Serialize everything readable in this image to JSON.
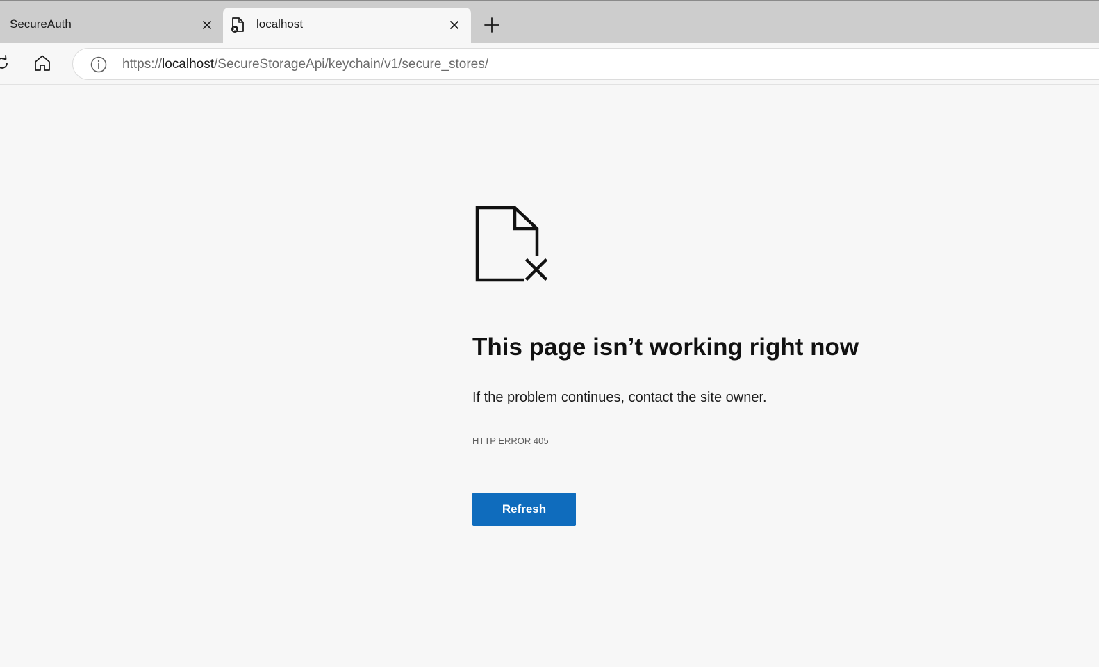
{
  "tabs": [
    {
      "title": "SecureAuth",
      "active": false
    },
    {
      "title": "localhost",
      "active": true,
      "favicon": "document-error-icon"
    }
  ],
  "toolbar": {
    "url_prefix": "https://",
    "url_host": "localhost",
    "url_path": "/SecureStorageApi/keychain/v1/secure_stores/"
  },
  "error": {
    "icon": "document-error-icon",
    "title": "This page isn’t working right now",
    "description": "If the problem continues, contact the site owner.",
    "code": "HTTP ERROR 405",
    "button_label": "Refresh"
  },
  "colors": {
    "accent": "#0f6cbd",
    "tabstrip": "#cdcdcd",
    "page_bg": "#f7f7f7"
  }
}
